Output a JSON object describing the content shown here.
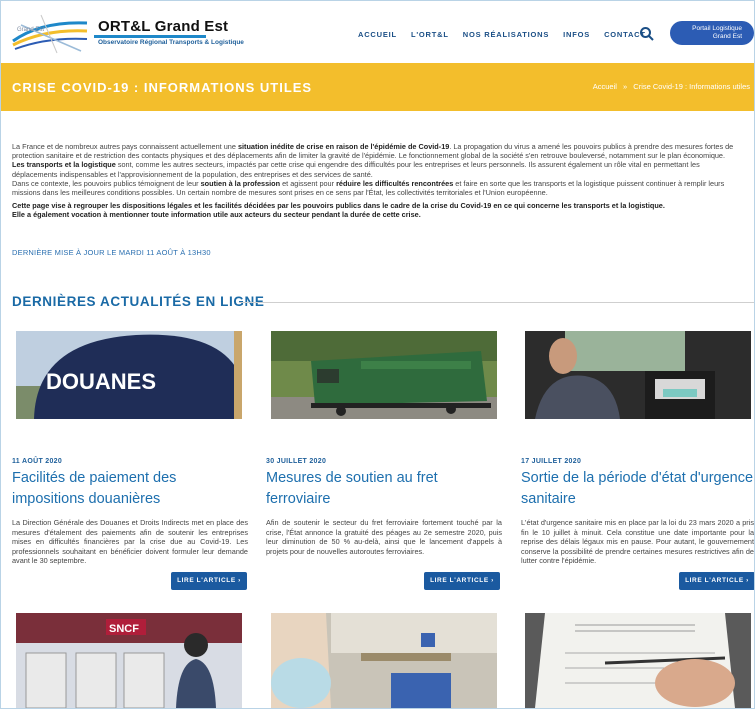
{
  "header": {
    "brand_name": "ORT&L Grand Est",
    "brand_subtitle": "Observatoire Régional Transports & Logistique",
    "nav": [
      "ACCUEIL",
      "L'ORT&L",
      "NOS RÉALISATIONS",
      "INFOS",
      "CONTACT"
    ],
    "portal_button": "Portail Logistique\nGrand Est"
  },
  "banner": {
    "title": "CRISE COVID-19 : INFORMATIONS UTILES",
    "breadcrumb_home": "Accueil",
    "breadcrumb_sep": "»",
    "breadcrumb_current": "Crise Covid-19 : Informations utiles"
  },
  "intro": {
    "p1_a": "La France et de nombreux autres pays connaissent actuellement une ",
    "p1_b": "situation inédite de crise en raison de l'épidémie de Covid-19",
    "p1_c": ". La propagation du virus a amené les pouvoirs publics à prendre des mesures fortes de protection sanitaire et de restriction des contacts physiques et des déplacements afin de limiter la gravité de l'épidémie. Le fonctionnement global de la société s'en retrouve bouleversé, notamment sur le plan économique.",
    "p2_a": "Les transports et la logistique",
    "p2_b": " sont, comme les autres secteurs, impactés par cette crise qui engendre des difficultés pour les entreprises et leurs personnels. Ils assurent également un rôle vital en permettant les déplacements indispensables et l'approvisionnement de la population, des entreprises et des services de santé.",
    "p3_a": "Dans ce contexte, les pouvoirs publics témoignent de leur ",
    "p3_b": "soutien à la profession",
    "p3_c": " et agissent pour ",
    "p3_d": "réduire les difficultés rencontrées",
    "p3_e": " et faire en sorte que les transports et la logistique puissent continuer à remplir leurs missions dans les meilleures conditions possibles. Un certain nombre de mesures sont prises en ce sens par l'État, les collectivités territoriales et l'Union européenne.",
    "p4": "Cette page vise à regrouper les dispositions légales et les facilités décidées par les pouvoirs publics dans le cadre de la crise du Covid-19 en ce qui concerne les transports et la logistique.",
    "p5": "Elle a également vocation à mentionner toute information utile aux acteurs du secteur pendant la durée de cette crise.",
    "update": "DERNIÈRE MISE À JOUR LE MARDI 11 AOÛT À 13H30"
  },
  "section": {
    "title": "DERNIÈRES ACTUALITÉS EN LIGNE"
  },
  "cards": [
    {
      "date": "11 AOÛT 2020",
      "title": "Facilités de paiement des impositions douanières",
      "text": "La Direction Générale des Douanes et Droits Indirects met en place des mesures d'étalement des paiements afin de soutenir les entreprises mises en difficultés financières par la crise due au Covid-19. Les professionnels souhaitant en bénéficier doivent formuler leur demande avant le 30 septembre.",
      "button": "LIRE L'ARTICLE",
      "image_text": "DOUANES"
    },
    {
      "date": "30 JUILLET 2020",
      "title": "Mesures de soutien au fret ferroviaire",
      "text": "Afin de soutenir le secteur du fret ferroviaire fortement touché par la crise, l'État annonce la gratuité des péages au 2e semestre 2020, puis leur diminution de 50 % au-delà, ainsi que le lancement d'appels à projets pour de nouvelles autoroutes ferroviaires.",
      "button": "LIRE L'ARTICLE"
    },
    {
      "date": "17 JUILLET 2020",
      "title": "Sortie de la période d'état d'urgence sanitaire",
      "text": "L'état d'urgence sanitaire mis en place par la loi du 23 mars 2020 a pris fin le 10 juillet à minuit. Cela constitue une date importante pour la reprise des délais légaux mis en pause. Pour autant, le gouvernement conserve la possibilité de prendre certaines mesures restrictives afin de lutter contre l'épidémie.",
      "button": "LIRE L'ARTICLE"
    }
  ],
  "second_row": {
    "sncf_logo": "SNCF"
  },
  "colors": {
    "banner": "#f3be2c",
    "nav": "#1b4f86",
    "accent": "#1d6fae",
    "button": "#1b5aa0"
  }
}
